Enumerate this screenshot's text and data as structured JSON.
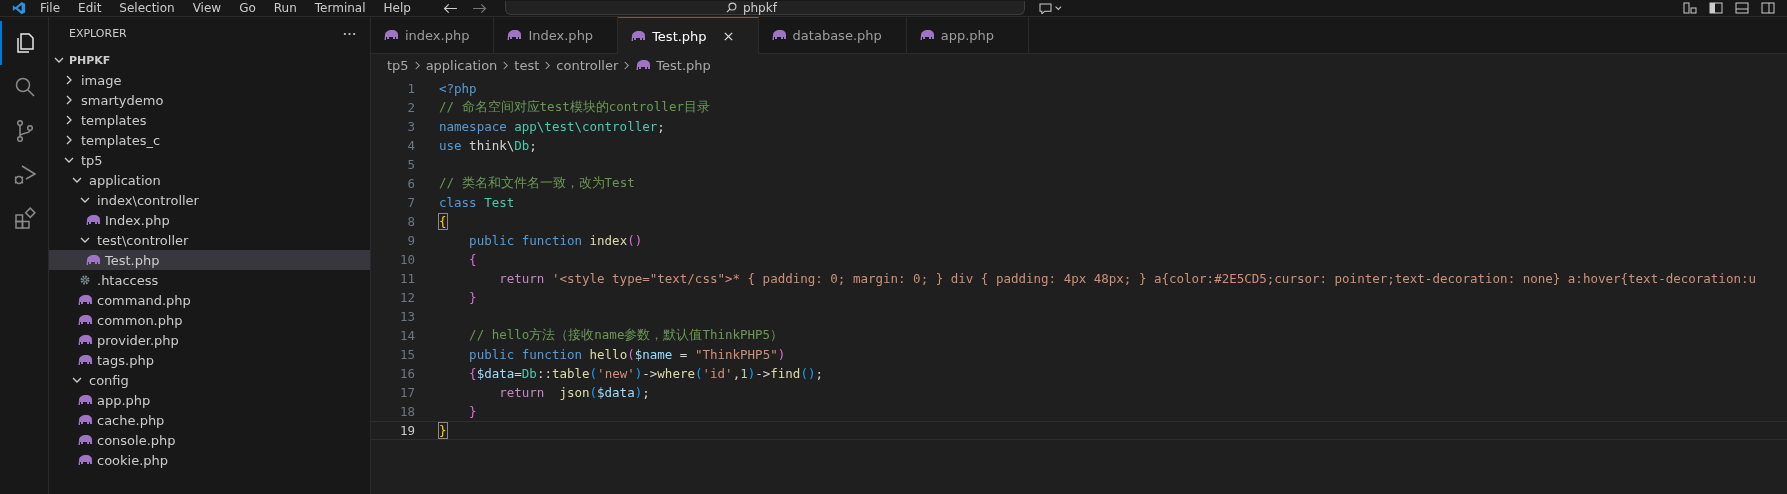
{
  "menu": [
    "File",
    "Edit",
    "Selection",
    "View",
    "Go",
    "Run",
    "Terminal",
    "Help"
  ],
  "search": {
    "value": "phpkf"
  },
  "activity_bar": [
    {
      "kind": "files",
      "selected": true
    },
    {
      "kind": "search",
      "selected": false
    },
    {
      "kind": "source-control",
      "selected": false
    },
    {
      "kind": "run",
      "selected": false
    },
    {
      "kind": "extensions",
      "selected": false
    }
  ],
  "explorer": {
    "title": "EXPLORER",
    "root": {
      "label": "PHPKF",
      "expanded": true
    },
    "items": [
      {
        "kind": "folder",
        "label": "image",
        "expanded": false,
        "selected": false
      },
      {
        "kind": "folder",
        "label": "smartydemo",
        "expanded": false,
        "selected": false
      },
      {
        "kind": "folder",
        "label": "templates",
        "expanded": false,
        "selected": false
      },
      {
        "kind": "folder",
        "label": "templates_c",
        "expanded": false,
        "selected": false
      },
      {
        "kind": "folder",
        "label": "tp5",
        "expanded": true,
        "selected": false,
        "children": [
          {
            "kind": "folder",
            "label": "application",
            "expanded": true,
            "selected": false,
            "children": [
              {
                "kind": "folder",
                "label": "index\\controller",
                "expanded": true,
                "selected": false,
                "children": [
                  {
                    "kind": "php",
                    "label": "Index.php",
                    "selected": false
                  }
                ]
              },
              {
                "kind": "folder",
                "label": "test\\controller",
                "expanded": true,
                "selected": false,
                "children": [
                  {
                    "kind": "php",
                    "label": "Test.php",
                    "selected": true
                  }
                ]
              },
              {
                "kind": "settings",
                "label": ".htaccess",
                "selected": false
              },
              {
                "kind": "php",
                "label": "command.php",
                "selected": false
              },
              {
                "kind": "php",
                "label": "common.php",
                "selected": false
              },
              {
                "kind": "php",
                "label": "provider.php",
                "selected": false
              },
              {
                "kind": "php",
                "label": "tags.php",
                "selected": false
              }
            ]
          },
          {
            "kind": "folder",
            "label": "config",
            "expanded": true,
            "selected": false,
            "children": [
              {
                "kind": "php",
                "label": "app.php",
                "selected": false
              },
              {
                "kind": "php",
                "label": "cache.php",
                "selected": false
              },
              {
                "kind": "php",
                "label": "console.php",
                "selected": false
              },
              {
                "kind": "php",
                "label": "cookie.php",
                "selected": false
              }
            ]
          }
        ]
      }
    ]
  },
  "tabs": [
    {
      "label": "index.php",
      "selected": false
    },
    {
      "label": "Index.php",
      "selected": false
    },
    {
      "label": "Test.php",
      "selected": true
    },
    {
      "label": "database.php",
      "selected": false
    },
    {
      "label": "app.php",
      "selected": false
    }
  ],
  "breadcrumb": [
    "tp5",
    "application",
    "test",
    "controller",
    "Test.php"
  ],
  "lines": [
    {
      "number": "1",
      "current": false,
      "tokens": [
        {
          "kind": "kw",
          "text": "<?php"
        }
      ]
    },
    {
      "number": "2",
      "current": false,
      "tokens": [
        {
          "kind": "cmt",
          "text": "// 命名空间对应test模块的controller目录"
        }
      ]
    },
    {
      "number": "3",
      "current": false,
      "tokens": [
        {
          "kind": "kw",
          "text": "namespace"
        },
        {
          "kind": "type",
          "text": " app\\test\\controller"
        },
        {
          "kind": "plain",
          "text": ";"
        }
      ]
    },
    {
      "number": "4",
      "current": false,
      "tokens": [
        {
          "kind": "kw",
          "text": "use"
        },
        {
          "kind": "plain",
          "text": " think\\"
        },
        {
          "kind": "type",
          "text": "Db"
        },
        {
          "kind": "plain",
          "text": ";"
        }
      ]
    },
    {
      "number": "5",
      "current": false
    },
    {
      "number": "6",
      "current": false,
      "tokens": [
        {
          "kind": "cmt",
          "text": "// 类名和文件名一致，改为Test"
        }
      ]
    },
    {
      "number": "7",
      "current": false,
      "tokens": [
        {
          "kind": "kw",
          "text": "class"
        },
        {
          "kind": "type",
          "text": " Test"
        }
      ]
    },
    {
      "number": "8",
      "current": false,
      "tokens": [
        {
          "kind": "b1",
          "text": "{",
          "matched": true
        }
      ]
    },
    {
      "number": "9",
      "current": false,
      "tokens": [
        {
          "kind": "kw",
          "text": "    public function"
        },
        {
          "kind": "fn",
          "text": " index"
        },
        {
          "kind": "b2",
          "text": "()"
        }
      ]
    },
    {
      "number": "10",
      "current": false,
      "tokens": [
        {
          "kind": "b2",
          "text": "    {"
        }
      ]
    },
    {
      "number": "11",
      "current": false,
      "tokens": [
        {
          "kind": "ctrl",
          "text": "        return"
        },
        {
          "kind": "str",
          "text": " '<style type=\"text/css\">* { padding: 0; margin: 0; } div { padding: 4px 48px; } a{color:#2E5CD5;cursor: pointer;text-decoration: none} a:hover{text-decoration:u"
        }
      ]
    },
    {
      "number": "12",
      "current": false,
      "tokens": [
        {
          "kind": "b2",
          "text": "    }"
        }
      ]
    },
    {
      "number": "13",
      "current": false
    },
    {
      "number": "14",
      "current": false,
      "tokens": [
        {
          "kind": "cmt",
          "text": "    // hello方法（接收name参数，默认值ThinkPHP5）"
        }
      ]
    },
    {
      "number": "15",
      "current": false,
      "tokens": [
        {
          "kind": "kw",
          "text": "    public function"
        },
        {
          "kind": "fn",
          "text": " hello"
        },
        {
          "kind": "b2",
          "text": "("
        },
        {
          "kind": "var",
          "text": "$name"
        },
        {
          "kind": "plain",
          "text": " = "
        },
        {
          "kind": "str",
          "text": "\"ThinkPHP5\""
        },
        {
          "kind": "b2",
          "text": ")"
        }
      ]
    },
    {
      "number": "16",
      "current": false,
      "tokens": [
        {
          "kind": "b2",
          "text": "    {"
        },
        {
          "kind": "var",
          "text": "$data"
        },
        {
          "kind": "plain",
          "text": "="
        },
        {
          "kind": "type",
          "text": "Db"
        },
        {
          "kind": "plain",
          "text": "::"
        },
        {
          "kind": "fn",
          "text": "table"
        },
        {
          "kind": "b3",
          "text": "("
        },
        {
          "kind": "str",
          "text": "'new'"
        },
        {
          "kind": "b3",
          "text": ")"
        },
        {
          "kind": "plain",
          "text": "->"
        },
        {
          "kind": "fn",
          "text": "where"
        },
        {
          "kind": "b3",
          "text": "("
        },
        {
          "kind": "str",
          "text": "'id'"
        },
        {
          "kind": "plain",
          "text": ","
        },
        {
          "kind": "num",
          "text": "1"
        },
        {
          "kind": "b3",
          "text": ")"
        },
        {
          "kind": "plain",
          "text": "->"
        },
        {
          "kind": "fn",
          "text": "find"
        },
        {
          "kind": "b3",
          "text": "()"
        },
        {
          "kind": "plain",
          "text": ";"
        }
      ]
    },
    {
      "number": "17",
      "current": false,
      "tokens": [
        {
          "kind": "ctrl",
          "text": "        return"
        },
        {
          "kind": "fn",
          "text": "  json"
        },
        {
          "kind": "b3",
          "text": "("
        },
        {
          "kind": "var",
          "text": "$data"
        },
        {
          "kind": "b3",
          "text": ")"
        },
        {
          "kind": "plain",
          "text": ";"
        }
      ]
    },
    {
      "number": "18",
      "current": false,
      "tokens": [
        {
          "kind": "b2",
          "text": "    }"
        }
      ]
    },
    {
      "number": "19",
      "current": true,
      "tokens": [
        {
          "kind": "b1",
          "text": "}",
          "matched": true
        }
      ]
    }
  ]
}
